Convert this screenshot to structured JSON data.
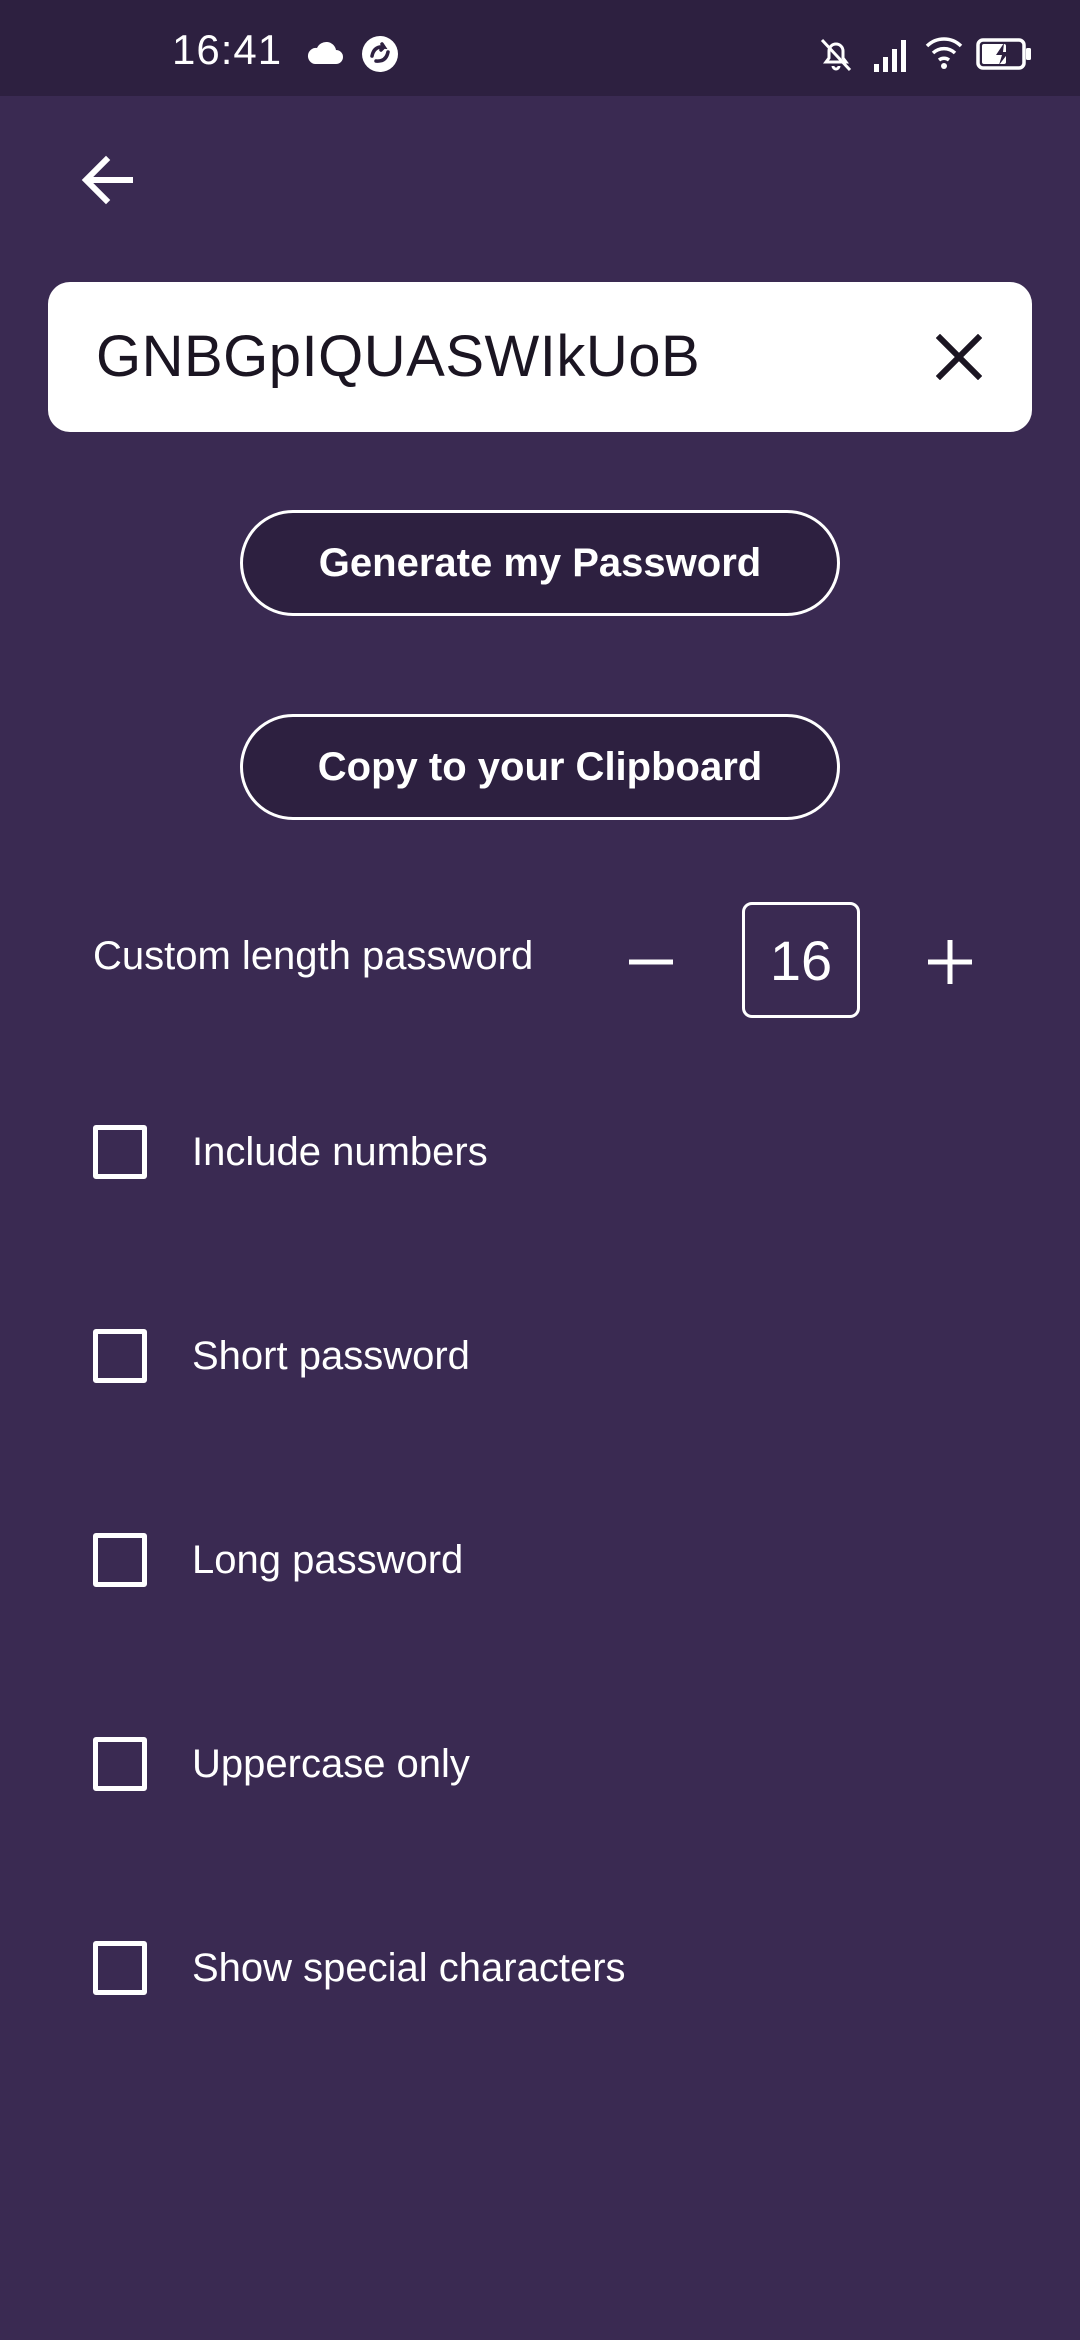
{
  "status_bar": {
    "time": "16:41",
    "icons": [
      "cloud-icon",
      "sync-badge-icon",
      "bell-muted-icon",
      "signal-icon",
      "wifi-icon",
      "battery-charging-icon"
    ]
  },
  "header": {
    "back_icon": "arrow-left-icon"
  },
  "password_field": {
    "value": "GNBGpIQUASWIkUoB",
    "clear_icon": "close-icon"
  },
  "actions": {
    "generate_label": "Generate my Password",
    "copy_label": "Copy to your Clipboard"
  },
  "length": {
    "label": "Custom length password",
    "value": "16",
    "decrement_icon": "minus-icon",
    "increment_icon": "plus-icon"
  },
  "options": [
    {
      "label": "Include numbers",
      "checked": false
    },
    {
      "label": "Short password",
      "checked": false
    },
    {
      "label": "Long password",
      "checked": false
    },
    {
      "label": "Uppercase only",
      "checked": false
    },
    {
      "label": "Show special characters",
      "checked": false
    }
  ],
  "colors": {
    "background": "#3a2a52",
    "status_bar": "#2d2040",
    "button_fill": "#2d2040",
    "field_background": "#ffffff",
    "foreground": "#ffffff"
  }
}
